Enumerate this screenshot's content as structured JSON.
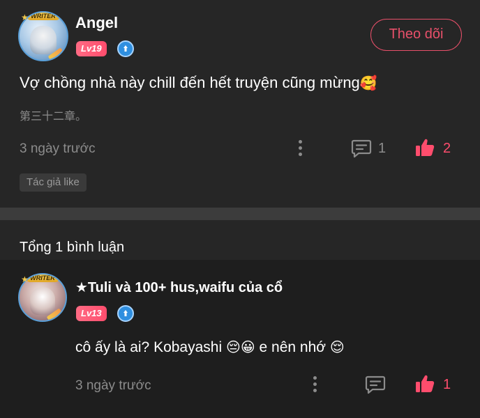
{
  "post": {
    "user": {
      "name": "Angel",
      "level": "Lv19",
      "avatar_badge": "WRITER"
    },
    "follow_label": "Theo dõi",
    "text": "Vợ chồng nhà này chill đến hết truyện cũng mừng",
    "text_emoji": "🥰",
    "chapter": "第三十二章。",
    "time": "3 ngày trước",
    "comment_count": "1",
    "like_count": "2",
    "author_like": "Tác giả like"
  },
  "total_comments": "Tổng 1 bình luận",
  "comment": {
    "user": {
      "name": "★Tuli và 100+ hus,waifu của cổ",
      "level": "Lv13",
      "avatar_badge": "WRITER"
    },
    "text_part1": "cô ấy là ai? Kobayashi ",
    "emoji1": "😔",
    "emoji2": "😀",
    "text_part2": " e nên nhớ ",
    "emoji3": "😌",
    "time": "3 ngày trước",
    "like_count": "1"
  },
  "colors": {
    "background": "#262626",
    "comment_background": "#1e1e1e",
    "divider": "#3c3c3c",
    "accent_pink": "#ff4d6d",
    "follow_border": "#e8506a",
    "muted_text": "#8c8c8c",
    "vip_blue": "#2f8fe0"
  },
  "icons": [
    "vip-badge-icon",
    "more-dots-icon",
    "comment-icon",
    "like-thumb-icon"
  ]
}
